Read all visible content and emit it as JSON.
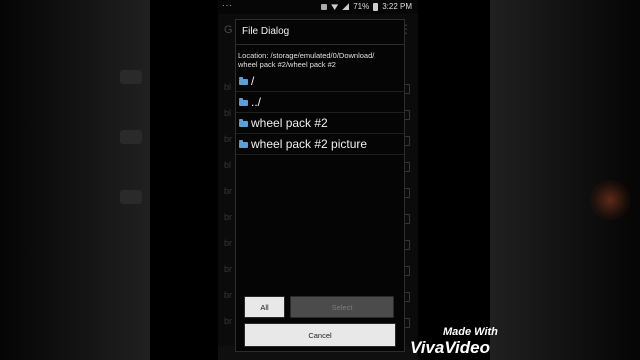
{
  "status_bar": {
    "menu_dots": "···",
    "battery": "71%",
    "time": "3:22 PM"
  },
  "background_app": {
    "title": "G",
    "menu_icon": "more-vert-icon",
    "rows": [
      "bl",
      "bl",
      "br",
      "bl",
      "br",
      "br",
      "br",
      "br",
      "br",
      "br"
    ]
  },
  "dialog": {
    "title": "File Dialog",
    "location": "Location: /storage/emulated/0/Download/\nwheel pack #2/wheel pack #2",
    "items": [
      {
        "label": "/",
        "icon": "folder-icon"
      },
      {
        "label": "../",
        "icon": "folder-icon"
      },
      {
        "label": "wheel pack #2",
        "icon": "folder-icon"
      },
      {
        "label": "wheel pack #2 picture",
        "icon": "folder-icon"
      }
    ],
    "buttons": {
      "all": "All",
      "select": "Select",
      "cancel": "Cancel"
    }
  },
  "watermark": {
    "line1": "Made With",
    "line2": "VivaVideo"
  },
  "colors": {
    "folder": "#5c9ed8",
    "dialog_bg": "#050505",
    "button_light": "#e8e8e8",
    "button_disabled": "#4b4b4b"
  }
}
